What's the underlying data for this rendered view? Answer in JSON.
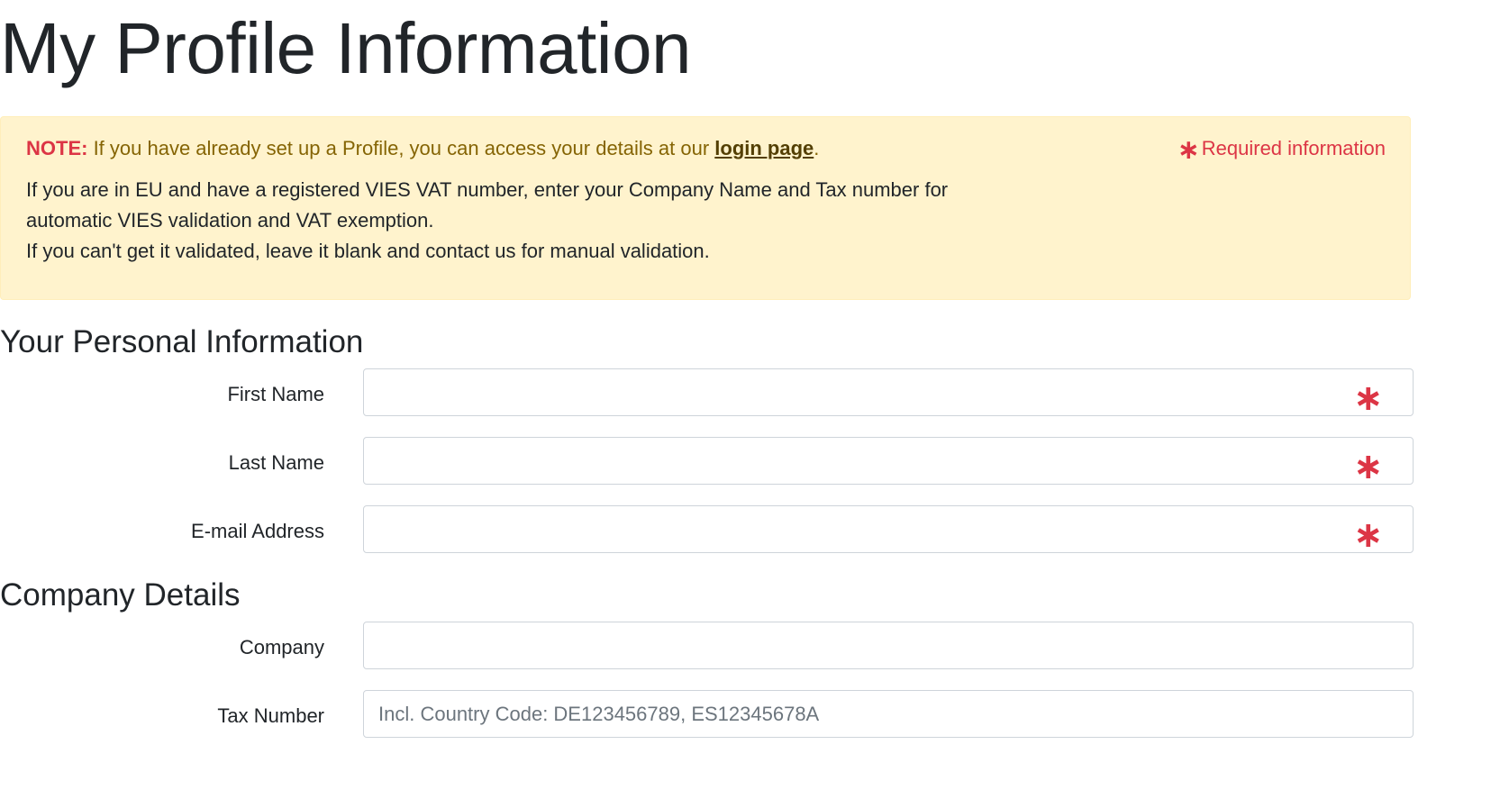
{
  "page": {
    "title": "My Profile Information"
  },
  "alert": {
    "note_label": "NOTE:",
    "note_text": " If you have already set up a Profile, you can access your details at our ",
    "login_link": "login page",
    "note_end": ".",
    "required_star": "∗",
    "required_text": "Required information",
    "body_line1": "If you are in EU and have a registered VIES VAT number, enter your Company Name and Tax number for",
    "body_line2": "automatic VIES validation and VAT exemption.",
    "body_line3": "If you can't get it validated, leave it blank and contact us for manual validation."
  },
  "personal": {
    "heading": "Your Personal Information",
    "first_name": {
      "label": "First Name",
      "value": "",
      "required": true
    },
    "last_name": {
      "label": "Last Name",
      "value": "",
      "required": true
    },
    "email": {
      "label": "E-mail Address",
      "value": "",
      "required": true
    }
  },
  "company": {
    "heading": "Company Details",
    "company": {
      "label": "Company",
      "value": ""
    },
    "tax_number": {
      "label": "Tax Number",
      "value": "",
      "placeholder": "Incl. Country Code: DE123456789, ES12345678A"
    }
  },
  "icons": {
    "required_mark": "∗"
  },
  "colors": {
    "alert_bg": "#fff3cd",
    "required": "#dc3545",
    "note_text": "#856404"
  }
}
